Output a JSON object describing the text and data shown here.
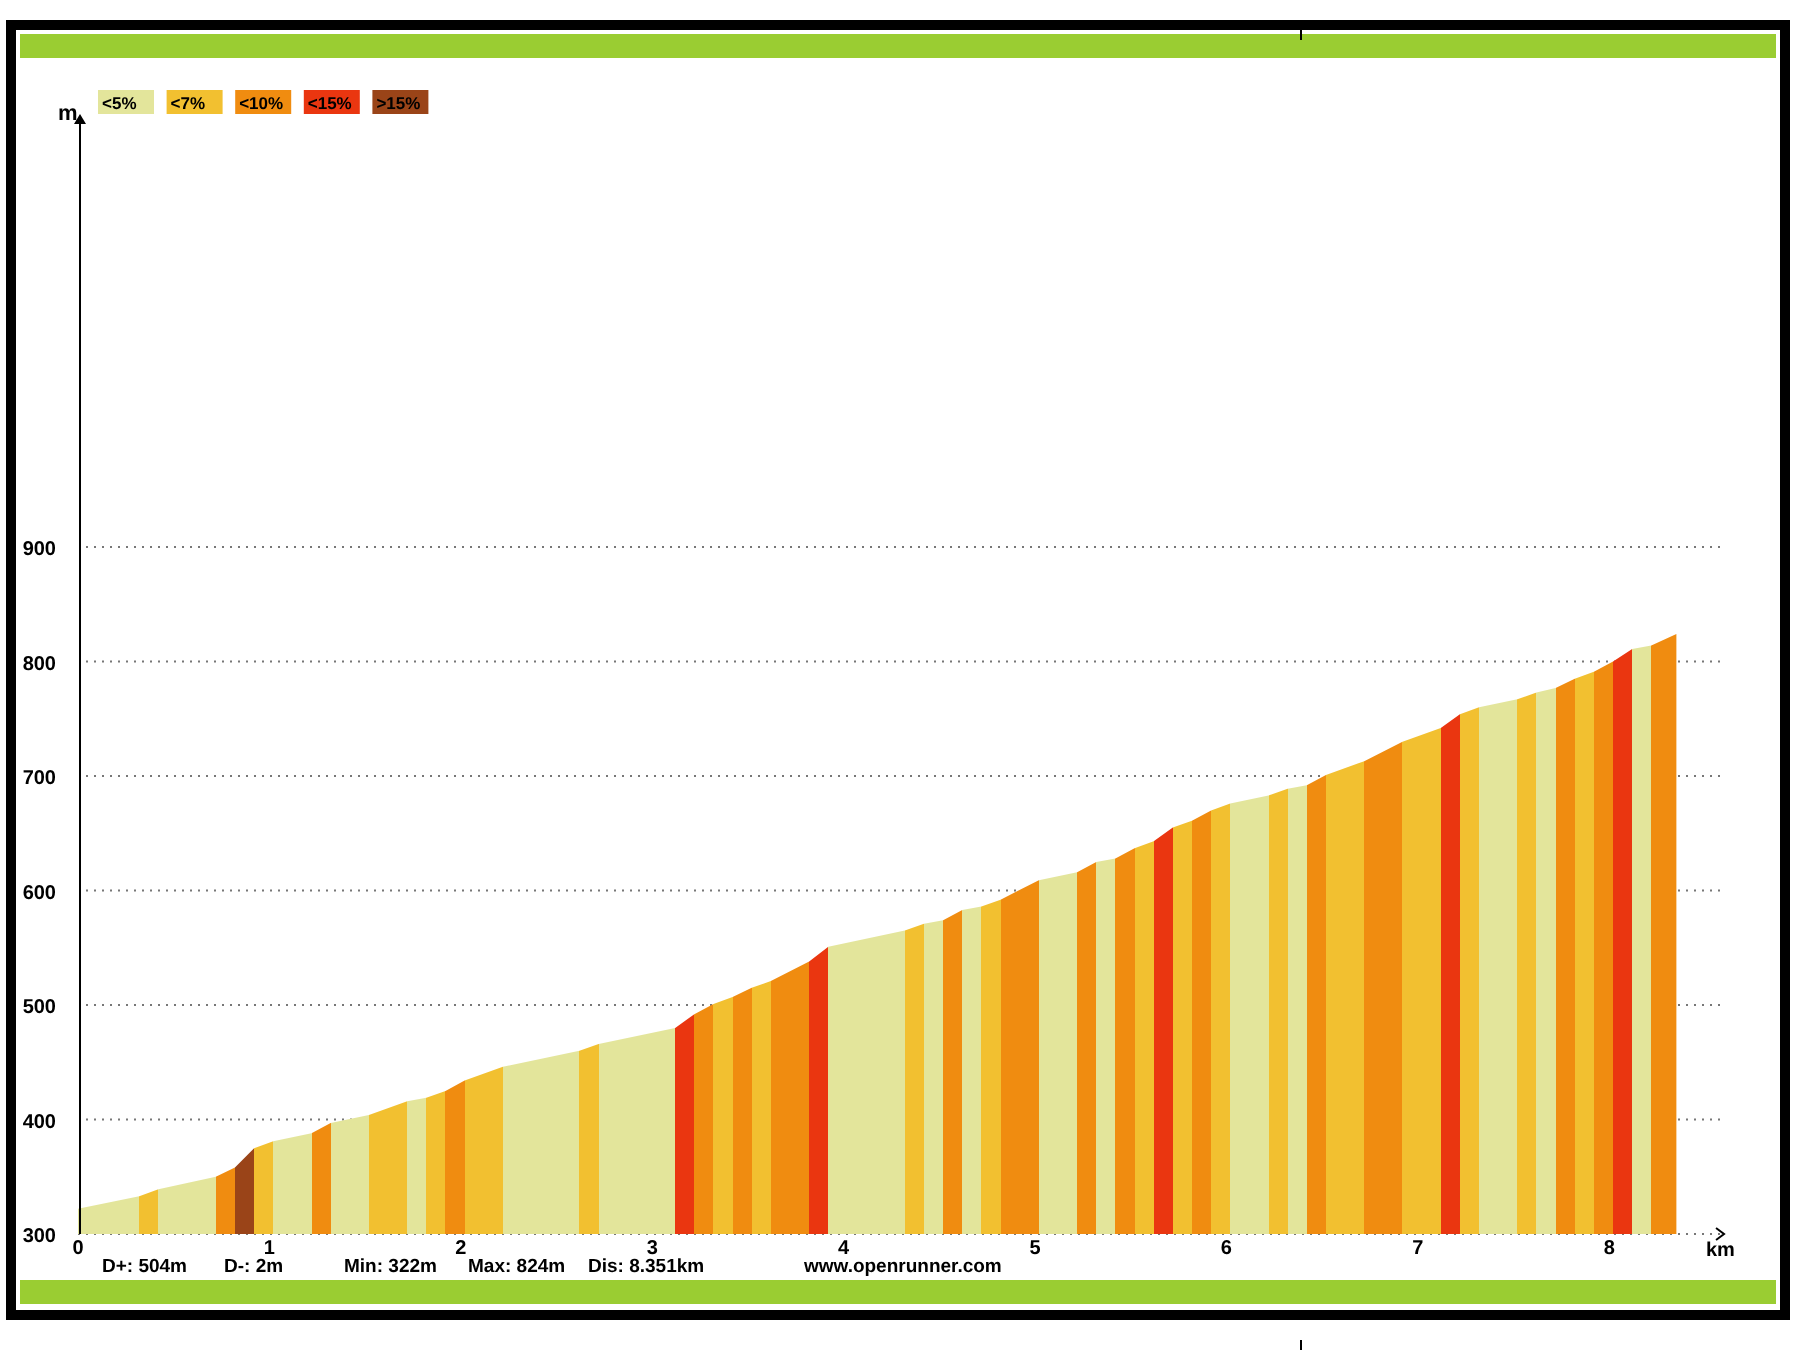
{
  "legend": [
    {
      "label": "<5%",
      "color": "#e3e59b"
    },
    {
      "label": "<7%",
      "color": "#f2c030"
    },
    {
      "label": "<10%",
      "color": "#f08c10"
    },
    {
      "label": "<15%",
      "color": "#ea3610"
    },
    {
      "label": ">15%",
      "color": "#9a4418"
    }
  ],
  "chart_data": {
    "type": "area",
    "xlabel": "km",
    "ylabel": "m",
    "xlim": [
      0,
      8.6
    ],
    "ylim": [
      300,
      1280
    ],
    "xticks": [
      0,
      1,
      2,
      3,
      4,
      5,
      6,
      7,
      8
    ],
    "yticks": [
      300,
      400,
      500,
      600,
      700,
      800,
      900
    ],
    "x": [
      0,
      0.32,
      0.42,
      0.72,
      0.82,
      0.92,
      1.02,
      1.22,
      1.32,
      1.52,
      1.72,
      1.82,
      1.92,
      2.02,
      2.22,
      2.62,
      2.72,
      3.12,
      3.22,
      3.32,
      3.42,
      3.52,
      3.62,
      3.82,
      3.92,
      4.32,
      4.42,
      4.52,
      4.62,
      4.72,
      4.82,
      5.02,
      5.22,
      5.32,
      5.42,
      5.52,
      5.62,
      5.72,
      5.82,
      5.92,
      6.02,
      6.22,
      6.32,
      6.42,
      6.52,
      6.72,
      6.92,
      7.12,
      7.22,
      7.32,
      7.52,
      7.62,
      7.72,
      7.82,
      7.92,
      8.02,
      8.12,
      8.22,
      8.351
    ],
    "values": [
      322,
      333,
      339,
      350,
      358,
      375,
      381,
      388,
      397,
      404,
      416,
      419,
      425,
      434,
      446,
      460,
      466,
      480,
      492,
      501,
      507,
      515,
      521,
      538,
      551,
      565,
      571,
      574,
      583,
      586,
      592,
      609,
      616,
      625,
      628,
      637,
      643,
      655,
      661,
      670,
      676,
      683,
      689,
      692,
      701,
      713,
      730,
      742,
      754,
      760,
      767,
      773,
      777,
      785,
      791,
      800,
      811,
      814,
      824
    ],
    "grid": true
  },
  "stats": [
    "D+: 504m",
    "D-: 2m",
    "Min: 322m",
    "Max: 824m",
    "Dis: 8.351km"
  ],
  "website": "www.openrunner.com"
}
